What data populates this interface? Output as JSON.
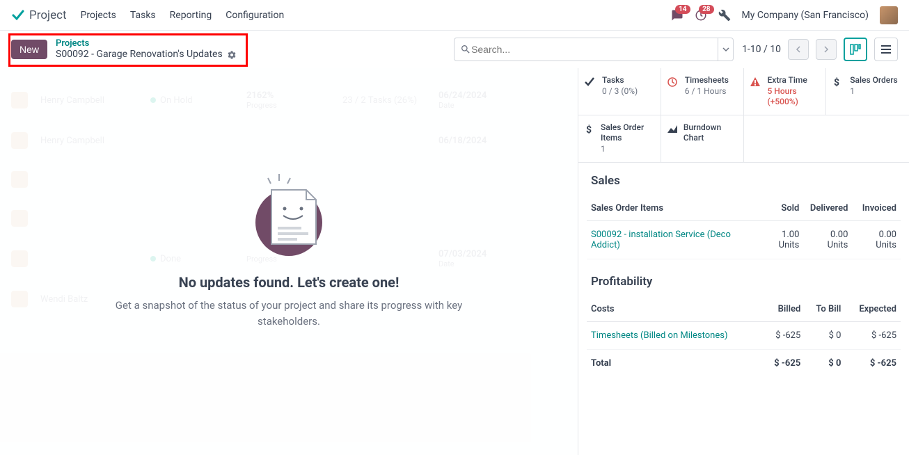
{
  "navbar": {
    "app": "Project",
    "items": [
      "Projects",
      "Tasks",
      "Reporting",
      "Configuration"
    ],
    "chat_badge": "14",
    "clock_badge": "28",
    "company": "My Company (San Francisco)"
  },
  "breadcrumb": {
    "new_label": "New",
    "parent": "Projects",
    "title": "S00092 - Garage Renovation's Updates"
  },
  "search": {
    "placeholder": "Search..."
  },
  "pager": {
    "range": "1-10 / 10"
  },
  "empty": {
    "title": "No updates found. Let's create one!",
    "subtitle": "Get a snapshot of the status of your project and share its progress with key stakeholders."
  },
  "bg_rows": [
    {
      "name": "Henry Campbell",
      "status": "On Hold",
      "progress": "2162%",
      "progress_lbl": "Progress",
      "tasks": "23 / 2 Tasks (26%)",
      "date": "06/24/2024",
      "date_lbl": "Date"
    },
    {
      "name": "Henry Campbell",
      "status": "",
      "progress": "",
      "progress_lbl": "",
      "tasks": "",
      "date": "06/18/2024",
      "date_lbl": ""
    },
    {
      "name": "",
      "status": "",
      "progress": "",
      "progress_lbl": "",
      "tasks": "",
      "date": "",
      "date_lbl": ""
    },
    {
      "name": "",
      "status": "",
      "progress": "",
      "progress_lbl": "",
      "tasks": "",
      "date": "",
      "date_lbl": ""
    },
    {
      "name": "",
      "status": "Done",
      "progress": "",
      "progress_lbl": "Progress",
      "tasks": "",
      "date": "07/03/2024",
      "date_lbl": "Date"
    },
    {
      "name": "Wendi Baltz",
      "status": "",
      "progress": "",
      "progress_lbl": "",
      "tasks": "",
      "date": "",
      "date_lbl": ""
    }
  ],
  "stats": {
    "tasks": {
      "title": "Tasks",
      "val": "0 / 3 (0%)"
    },
    "timesheets": {
      "title": "Timesheets",
      "val": "6 / 1 Hours"
    },
    "extra": {
      "title": "Extra Time",
      "val1": "5 Hours",
      "val2": "(+500%)"
    },
    "sales_orders": {
      "title": "Sales Orders",
      "val": "1"
    },
    "so_items": {
      "title": "Sales Order Items",
      "val": "1"
    },
    "burndown": {
      "title": "Burndown Chart"
    }
  },
  "sales": {
    "heading": "Sales",
    "headers": [
      "Sales Order Items",
      "Sold",
      "Delivered",
      "Invoiced"
    ],
    "rows": [
      {
        "name": "S00092 - installation Service (Deco Addict)",
        "sold": "1.00 Units",
        "delivered": "0.00 Units",
        "invoiced": "0.00 Units"
      }
    ]
  },
  "profit": {
    "heading": "Profitability",
    "headers": [
      "Costs",
      "Billed",
      "To Bill",
      "Expected"
    ],
    "rows": [
      {
        "name": "Timesheets (Billed on Milestones)",
        "billed": "$ -625",
        "tobill": "$ 0",
        "expected": "$ -625"
      }
    ],
    "total": {
      "label": "Total",
      "billed": "$ -625",
      "tobill": "$ 0",
      "expected": "$ -625"
    }
  }
}
